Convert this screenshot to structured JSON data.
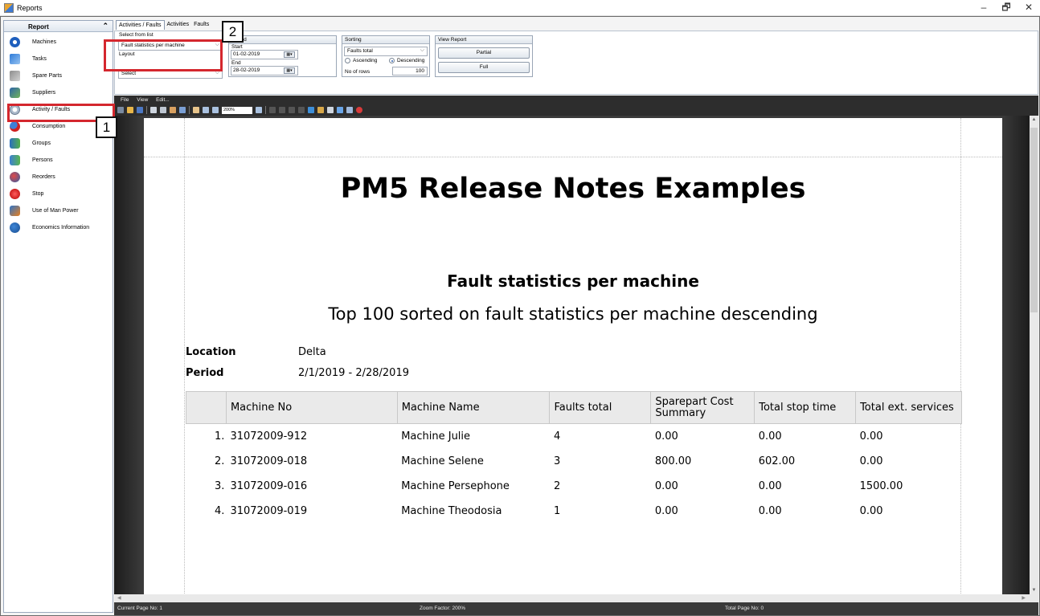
{
  "window": {
    "title": "Reports",
    "minimize": "–",
    "maximize": "🗗",
    "close": "✕"
  },
  "left_panel": {
    "header": "Report",
    "collapse_glyph": "⌃",
    "items": [
      {
        "label": "Machines",
        "icon": "machines-icon"
      },
      {
        "label": "Tasks",
        "icon": "tasks-icon"
      },
      {
        "label": "Spare Parts",
        "icon": "spare-parts-icon"
      },
      {
        "label": "Suppliers",
        "icon": "suppliers-icon"
      },
      {
        "label": "Activity / Faults",
        "icon": "activity-faults-icon"
      },
      {
        "label": "Consumption",
        "icon": "consumption-icon"
      },
      {
        "label": "Groups",
        "icon": "groups-icon"
      },
      {
        "label": "Persons",
        "icon": "persons-icon"
      },
      {
        "label": "Reorders",
        "icon": "reorders-icon"
      },
      {
        "label": "Stop",
        "icon": "stop-icon"
      },
      {
        "label": "Use of Man Power",
        "icon": "man-power-icon"
      },
      {
        "label": "Economics Information",
        "icon": "economics-icon"
      }
    ]
  },
  "callouts": {
    "one": "1",
    "two": "2",
    "color": "#d4272e"
  },
  "tabs": [
    "Activities / Faults",
    "Activities",
    "Faults"
  ],
  "params": {
    "select_from_list": {
      "label": "Select from list",
      "value": "Fault statistics per machine",
      "layout_label": "Layout",
      "layout_value": "Select"
    },
    "period": {
      "header": "Period",
      "start_label": "Start",
      "start_value": "01-02-2019",
      "end_label": "End",
      "end_value": "28-02-2019"
    },
    "sorting": {
      "header": "Sorting",
      "value": "Faults total",
      "ascending": "Ascending",
      "descending": "Descending",
      "rows_label": "No of rows",
      "rows_value": "100"
    },
    "view_report": {
      "header": "View Report",
      "partial": "Partial",
      "full": "Full"
    }
  },
  "viewer": {
    "menu": [
      "File",
      "View",
      "Edit..."
    ],
    "zoom": "200%",
    "status": {
      "page": "Current Page No: 1",
      "zoom": "Zoom Factor: 200%",
      "total": "Total Page No: 0"
    }
  },
  "report": {
    "title": "PM5 Release Notes Examples",
    "subtitle": "Fault statistics per machine",
    "subtitle2": "Top 100 sorted on fault statistics per machine descending",
    "location_label": "Location",
    "location_value": "Delta",
    "period_label": "Period",
    "period_value": "2/1/2019 - 2/28/2019",
    "columns": [
      "",
      "Machine No",
      "Machine Name",
      "Faults total",
      "Sparepart Cost Summary",
      "Total stop time",
      "Total ext. services"
    ],
    "rows": [
      {
        "idx": "1.",
        "no": "31072009-912",
        "name": "Machine Julie",
        "faults": "4",
        "cost": "0.00",
        "stop": "0.00",
        "ext": "0.00"
      },
      {
        "idx": "2.",
        "no": "31072009-018",
        "name": "Machine Selene",
        "faults": "3",
        "cost": "800.00",
        "stop": "602.00",
        "ext": "0.00"
      },
      {
        "idx": "3.",
        "no": "31072009-016",
        "name": "Machine Persephone",
        "faults": "2",
        "cost": "0.00",
        "stop": "0.00",
        "ext": "1500.00"
      },
      {
        "idx": "4.",
        "no": "31072009-019",
        "name": "Machine Theodosia",
        "faults": "1",
        "cost": "0.00",
        "stop": "0.00",
        "ext": "0.00"
      }
    ]
  }
}
